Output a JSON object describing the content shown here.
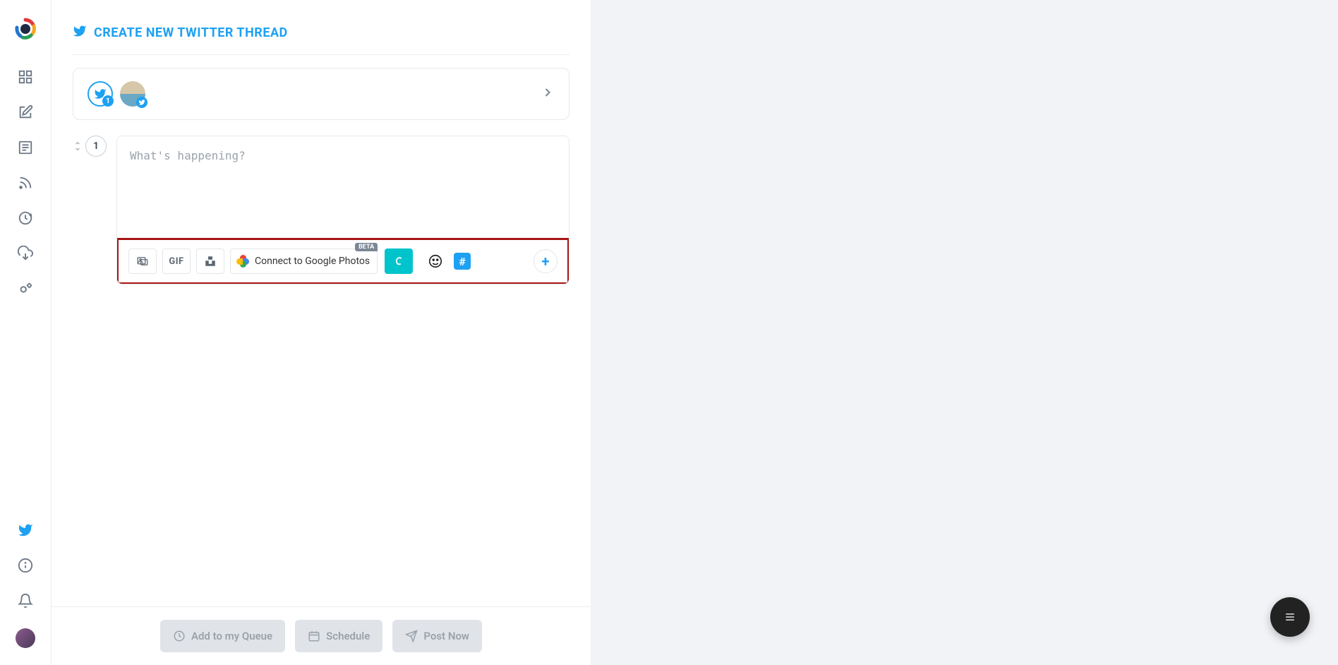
{
  "page_title": "CREATE NEW TWITTER THREAD",
  "account_badge_count": "1",
  "tweet_index": "1",
  "composer": {
    "placeholder": "What's happening?",
    "value": ""
  },
  "toolbar": {
    "gif_label": "GIF",
    "gphotos_label": "Connect to Google Photos",
    "gphotos_badge": "BETA",
    "hashtag_symbol": "#",
    "add_symbol": "+"
  },
  "footer": {
    "queue": "Add to my Queue",
    "schedule": "Schedule",
    "post_now": "Post Now"
  }
}
